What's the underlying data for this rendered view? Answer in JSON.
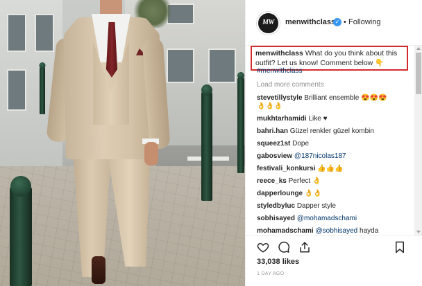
{
  "post": {
    "username": "menwithclass",
    "avatar_text": "MW",
    "follow_separator": "•",
    "follow_label": "Following",
    "verified_glyph": "✓"
  },
  "caption": {
    "username": "menwithclass",
    "text": "What do you think about this outfit? Let us know! Comment below 👇",
    "hashtag": "#menwithclass",
    "highlight_color": "#d32b2b"
  },
  "load_more_label": "Load more comments",
  "comments": [
    {
      "user": "stevetillystyle",
      "text": "Brilliant ensemble 😍😍😍",
      "extra": "👌👌👌"
    },
    {
      "user": "mukhtarhamidi",
      "text": "Like ♥"
    },
    {
      "user": "bahri.han",
      "text": "Güzel renkler güzel kombin"
    },
    {
      "user": "squeez1st",
      "text": "Dope"
    },
    {
      "user": "gabosview",
      "mention": "@187nicolas187"
    },
    {
      "user": "festivali_konkursi",
      "text": "👍👍👍"
    },
    {
      "user": "reece_ks",
      "text": "Perfect 👌"
    },
    {
      "user": "dapperlounge",
      "text": "👌👌"
    },
    {
      "user": "styledbyluc",
      "text": "Dapper style"
    },
    {
      "user": "sobhisayed",
      "mention": "@mohamadschami"
    },
    {
      "user": "mohamadschami",
      "mention": "@sobhisayed",
      "text": "hayda"
    }
  ],
  "likes": "33,038 likes",
  "posted": "1 DAY AGO",
  "icons": {
    "like": "heart-icon",
    "comment": "comment-icon",
    "share": "share-icon",
    "save": "bookmark-icon"
  },
  "colors": {
    "link": "#003569",
    "muted": "#8e8e8e",
    "verified": "#3897f0"
  }
}
